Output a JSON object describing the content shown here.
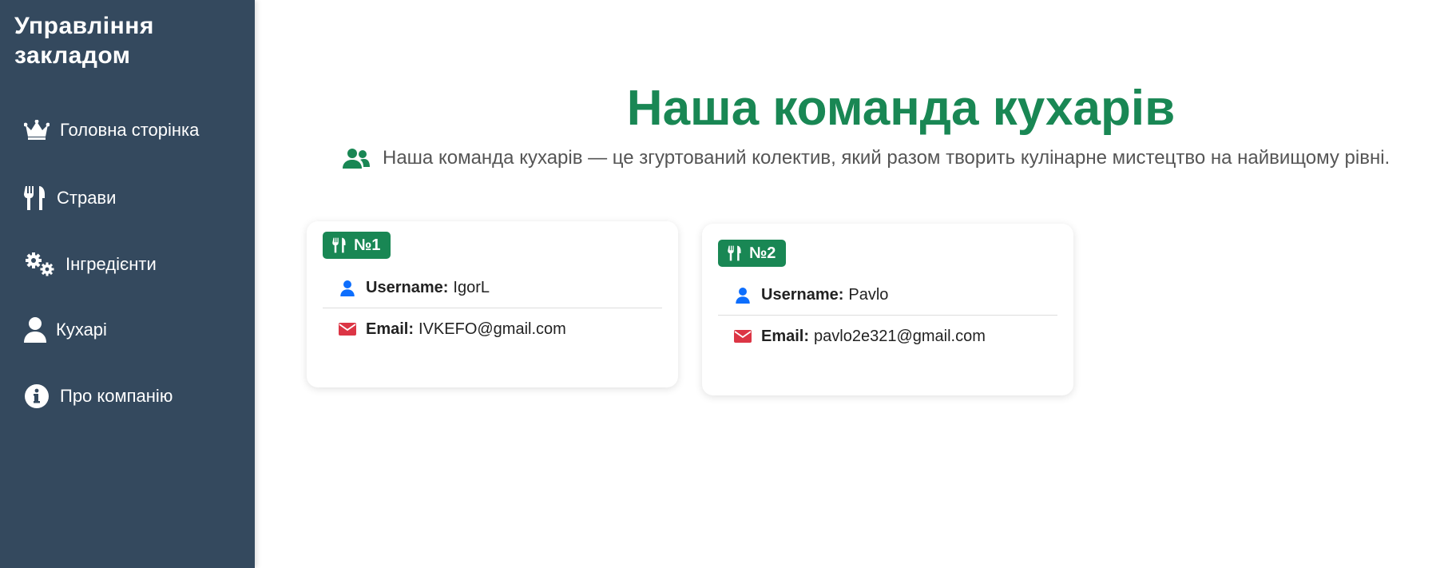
{
  "sidebar": {
    "brand": "Управління закладом",
    "items": [
      {
        "label": "Головна сторінка",
        "icon": "crown-icon"
      },
      {
        "label": "Страви",
        "icon": "utensils-icon"
      },
      {
        "label": "Інгредієнти",
        "icon": "gears-icon"
      },
      {
        "label": "Кухарі",
        "icon": "user-icon"
      },
      {
        "label": "Про компанію",
        "icon": "info-circle-icon"
      }
    ]
  },
  "main": {
    "title": "Наша команда кухарів",
    "subtitle": "Наша команда кухарів — це згуртований колектив, який разом творить кулінарне мистецтво на найвищому рівні.",
    "subtitle_icon": "users-icon",
    "username_label": "Username:",
    "email_label": "Email:",
    "cooks": [
      {
        "badge": "№1",
        "username": "IgorL",
        "email": "IVKEFO@gmail.com"
      },
      {
        "badge": "№2",
        "username": "Pavlo",
        "email": "pavlo2e321@gmail.com"
      }
    ]
  },
  "colors": {
    "sidebar_bg": "#34495e",
    "accent_green": "#198754",
    "user_icon_blue": "#0d6efd",
    "email_icon_red": "#dc3545",
    "subtitle_text": "#555555"
  }
}
